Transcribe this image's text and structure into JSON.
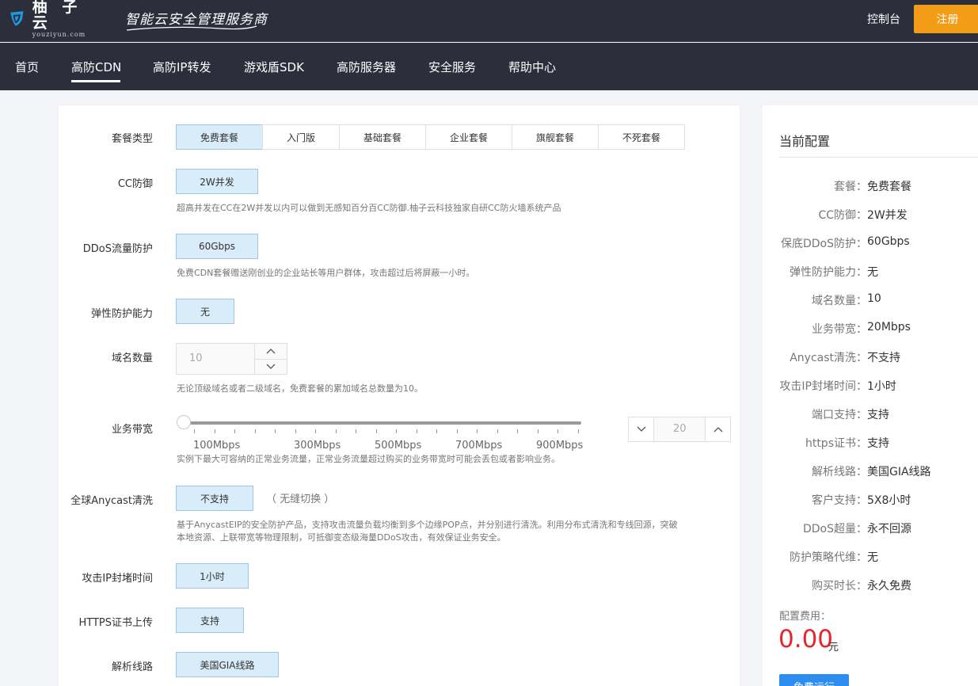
{
  "header": {
    "logo_cn": "柚 子 云",
    "logo_en": "youziyun.com",
    "slogan": "智能云安全管理服务商",
    "console_label": "控制台",
    "register_label": "注册"
  },
  "nav": {
    "items": [
      "首页",
      "高防CDN",
      "高防IP转发",
      "游戏盾SDK",
      "高防服务器",
      "安全服务",
      "帮助中心"
    ],
    "active": "高防CDN"
  },
  "form": {
    "package_type": {
      "label": "套餐类型",
      "options": [
        "免费套餐",
        "入门版",
        "基础套餐",
        "企业套餐",
        "旗舰套餐",
        "不死套餐"
      ],
      "selected": "免费套餐"
    },
    "cc": {
      "label": "CC防御",
      "value": "2W并发",
      "hint": "超高并发在CC在2W并发以内可以做到无感知百分百CC防御.柚子云科技独家自研CC防火墙系统产品"
    },
    "ddos": {
      "label": "DDoS流量防护",
      "value": "60Gbps",
      "hint": "免费CDN套餐赠送刚创业的企业站长等用户群体，攻击超过后将屏蔽一小时。"
    },
    "elastic": {
      "label": "弹性防护能力",
      "value": "无"
    },
    "domains": {
      "label": "域名数量",
      "value": "10",
      "hint": "无论顶级域名或者二级域名，免费套餐的累加域名总数量为10。"
    },
    "bandwidth": {
      "label": "业务带宽",
      "tick_labels": [
        "100Mbps",
        "300Mbps",
        "500Mbps",
        "700Mbps",
        "900Mbps"
      ],
      "value": "20",
      "slider_fraction": 0,
      "hint": "实例下最大可容纳的正常业务流量，正常业务流量超过购买的业务带宽时可能会丢包或者影响业务。"
    },
    "anycast": {
      "label": "全球Anycast清洗",
      "value": "不支持",
      "note": "（ 无缝切换 ）",
      "hint_line1": "基于AnycastEIP的安全防护产品，支持攻击流量负载均衡到多个边缘POP点，并分别进行清洗。利用分布式清洗和专线回源，突破",
      "hint_line2": "本地资源、上联带宽等物理限制，可抵御变态级海量DDoS攻击，有效保证业务安全。"
    },
    "ip_block": {
      "label": "攻击IP封堵时间",
      "value": "1小时"
    },
    "https": {
      "label": "HTTPS证书上传",
      "value": "支持"
    },
    "dns_line": {
      "label": "解析线路",
      "value": "美国GIA线路"
    }
  },
  "summary": {
    "title": "当前配置",
    "rows": [
      {
        "key": "套餐：",
        "value": "免费套餐"
      },
      {
        "key": "CC防御：",
        "value": "2W并发"
      },
      {
        "key": "保底DDoS防护：",
        "value": "60Gbps"
      },
      {
        "key": "弹性防护能力：",
        "value": "无"
      },
      {
        "key": "域名数量：",
        "value": "10"
      },
      {
        "key": "业务带宽：",
        "value": "20Mbps"
      },
      {
        "key": "Anycast清洗：",
        "value": "不支持"
      },
      {
        "key": "攻击IP封堵时间：",
        "value": "1小时"
      },
      {
        "key": "端口支持：",
        "value": "支持"
      },
      {
        "key": "https证书：",
        "value": "支持"
      },
      {
        "key": "解析线路：",
        "value": "美国GIA线路"
      },
      {
        "key": "客户支持：",
        "value": "5X8小时"
      },
      {
        "key": "DDoS超量：",
        "value": "永不回源"
      },
      {
        "key": "防护策略代维：",
        "value": "无"
      },
      {
        "key": "购买时长：",
        "value": "永久免费"
      }
    ],
    "fee_label": "配置费用：",
    "fee_amount": "0.00",
    "fee_unit": "元",
    "buy_label": "免费运行"
  },
  "colors": {
    "header_bg": "#2c2e3c",
    "accent_orange": "#f39c18",
    "selected_bg": "#d9ecf9",
    "price_red": "#e3262b",
    "button_blue": "#2d8cf0"
  }
}
